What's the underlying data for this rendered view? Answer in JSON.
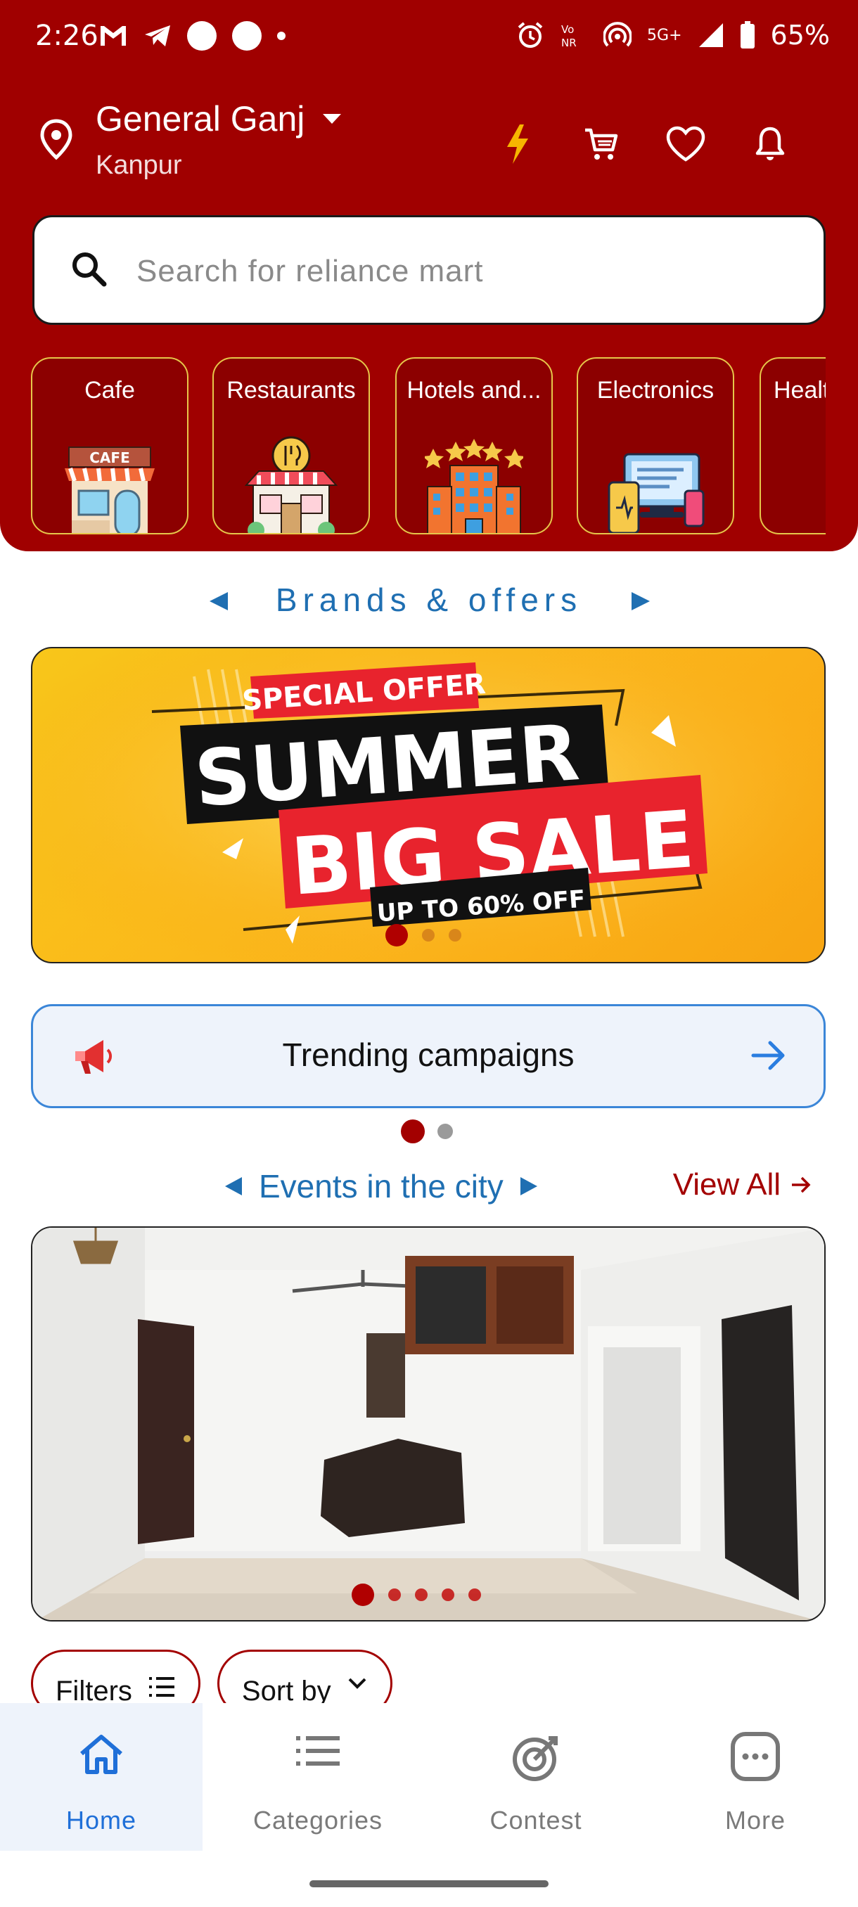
{
  "status_bar": {
    "time": "2:26",
    "battery": "65%",
    "network": "5G+"
  },
  "location": {
    "title": "General Ganj",
    "subtitle": "Kanpur"
  },
  "search": {
    "placeholder": "Search for reliance mart"
  },
  "categories": [
    {
      "label": "Cafe",
      "icon": "cafe-icon"
    },
    {
      "label": "Restaurants",
      "icon": "restaurant-icon"
    },
    {
      "label": "Hotels and...",
      "icon": "hotel-icon"
    },
    {
      "label": "Electronics",
      "icon": "electronics-icon"
    },
    {
      "label": "Healt",
      "icon": "health-icon"
    }
  ],
  "brands": {
    "title": "Brands & offers",
    "banner": {
      "top_tag": "SPECIAL OFFER",
      "line1": "SUMMER",
      "line2": "BIG SALE",
      "bottom_tag": "UP TO 60% OFF",
      "slides": 3,
      "active_slide": 1
    }
  },
  "trending": {
    "label": "Trending campaigns",
    "slides": 2,
    "active_slide": 1
  },
  "events": {
    "title": "Events in the city",
    "view_all": "View All",
    "slides": 5,
    "active_slide": 1
  },
  "controls": {
    "filters": "Filters",
    "sort": "Sort by"
  },
  "bottom_nav": [
    {
      "label": "Home",
      "icon": "home-icon",
      "active": true
    },
    {
      "label": "Categories",
      "icon": "list-icon",
      "active": false
    },
    {
      "label": "Contest",
      "icon": "target-icon",
      "active": false
    },
    {
      "label": "More",
      "icon": "more-icon",
      "active": false
    }
  ],
  "colors": {
    "brand_red": "#a00000",
    "accent_blue": "#1f6fb2",
    "nav_active": "#1f6fd8"
  }
}
